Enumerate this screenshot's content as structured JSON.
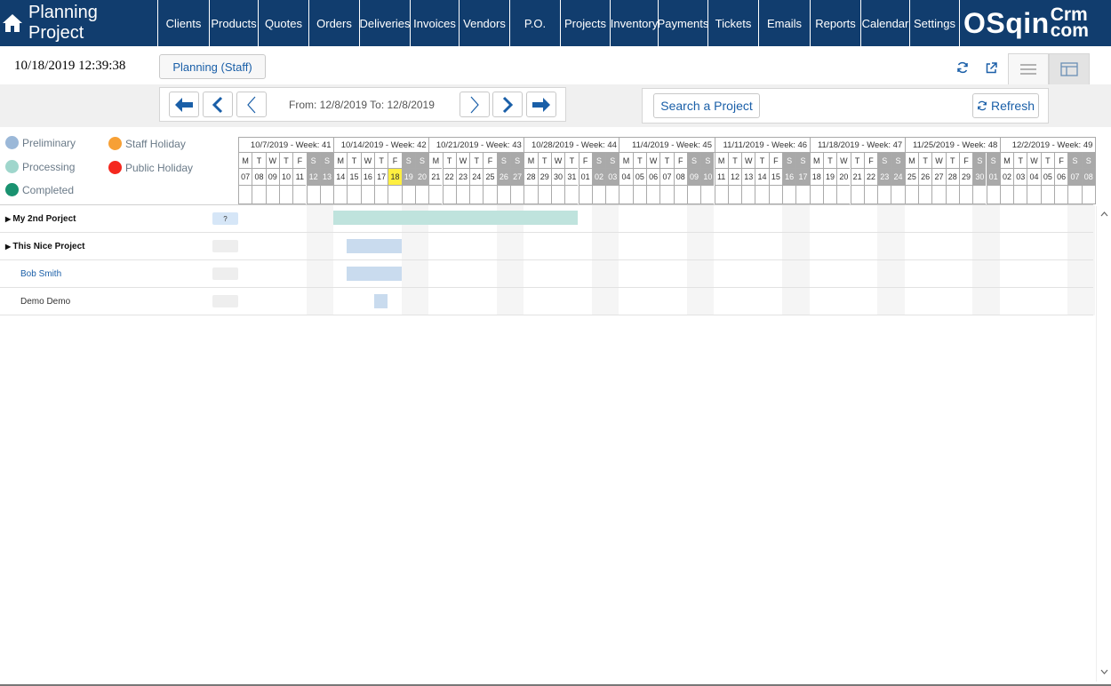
{
  "app": {
    "title": "Planning Project",
    "brand_main": "OSqin",
    "brand_top": "Crm",
    "brand_bottom": "com"
  },
  "nav": [
    {
      "label": "Clients",
      "w": 58
    },
    {
      "label": "Products",
      "w": 55
    },
    {
      "label": "Quotes",
      "w": 57
    },
    {
      "label": "Orders",
      "w": 57
    },
    {
      "label": "Deliveries",
      "w": 57
    },
    {
      "label": "Invoices",
      "w": 55
    },
    {
      "label": "Vendors",
      "w": 57
    },
    {
      "label": "P.O.",
      "w": 57
    },
    {
      "label": "Projects",
      "w": 56
    },
    {
      "label": "Inventory",
      "w": 54
    },
    {
      "label": "Payments",
      "w": 56
    },
    {
      "label": "Tickets",
      "w": 57
    },
    {
      "label": "Emails",
      "w": 58
    },
    {
      "label": "Reports",
      "w": 57
    },
    {
      "label": "Calendar",
      "w": 55
    },
    {
      "label": "Settings",
      "w": 56
    }
  ],
  "header": {
    "datetime": "10/18/2019 12:39:38",
    "planning_label": "Planning (Staff)"
  },
  "toolbar": {
    "range": "From: 12/8/2019 To: 12/8/2019",
    "search_label": "Search a Project",
    "refresh_label": "Refresh"
  },
  "legend": [
    {
      "label": "Preliminary",
      "color": "#9bb8d8"
    },
    {
      "label": "Staff Holiday",
      "color": "#f7a035"
    },
    {
      "label": "Processing",
      "color": "#9fd6cc"
    },
    {
      "label": "Public Holiday",
      "color": "#f5281e"
    },
    {
      "label": "Completed",
      "color": "#1a9270"
    }
  ],
  "calendar": {
    "weeks": [
      "10/7/2019 - Week: 41",
      "10/14/2019 - Week: 42",
      "10/21/2019 - Week: 43",
      "10/28/2019 - Week: 44",
      "11/4/2019 - Week: 45",
      "11/11/2019 - Week: 46",
      "11/18/2019 - Week: 47",
      "11/25/2019 - Week: 48",
      "12/2/2019 - Week: 49"
    ],
    "weekday_letters": [
      "M",
      "T",
      "W",
      "T",
      "F",
      "S",
      "S"
    ],
    "days": [
      "07",
      "08",
      "09",
      "10",
      "11",
      "12",
      "13",
      "14",
      "15",
      "16",
      "17",
      "18",
      "19",
      "20",
      "21",
      "22",
      "23",
      "24",
      "25",
      "26",
      "27",
      "28",
      "29",
      "30",
      "31",
      "01",
      "02",
      "03",
      "04",
      "05",
      "06",
      "07",
      "08",
      "09",
      "10",
      "11",
      "12",
      "13",
      "14",
      "15",
      "16",
      "17",
      "18",
      "19",
      "20",
      "21",
      "22",
      "23",
      "24",
      "25",
      "26",
      "27",
      "28",
      "29",
      "30",
      "01",
      "02",
      "03",
      "04",
      "05",
      "06",
      "07",
      "08"
    ],
    "today": "18"
  },
  "rows": [
    {
      "label": "My 2nd Porject",
      "style": "bold",
      "expand": true,
      "flag": "?",
      "bar": {
        "start": 7,
        "end": 24,
        "color": "#bfe3dd"
      }
    },
    {
      "label": "This Nice Project",
      "style": "bold",
      "expand": true,
      "flag": "",
      "bar": {
        "start": 8,
        "end": 11,
        "color": "#c9dbee"
      }
    },
    {
      "label": "Bob Smith",
      "style": "link",
      "expand": false,
      "flag": "",
      "bar": {
        "start": 8,
        "end": 11,
        "color": "#c9dbee"
      }
    },
    {
      "label": "Demo Demo",
      "style": "plain",
      "expand": false,
      "flag": "",
      "bar": {
        "start": 10,
        "end": 10,
        "color": "#c9dbee"
      }
    }
  ]
}
